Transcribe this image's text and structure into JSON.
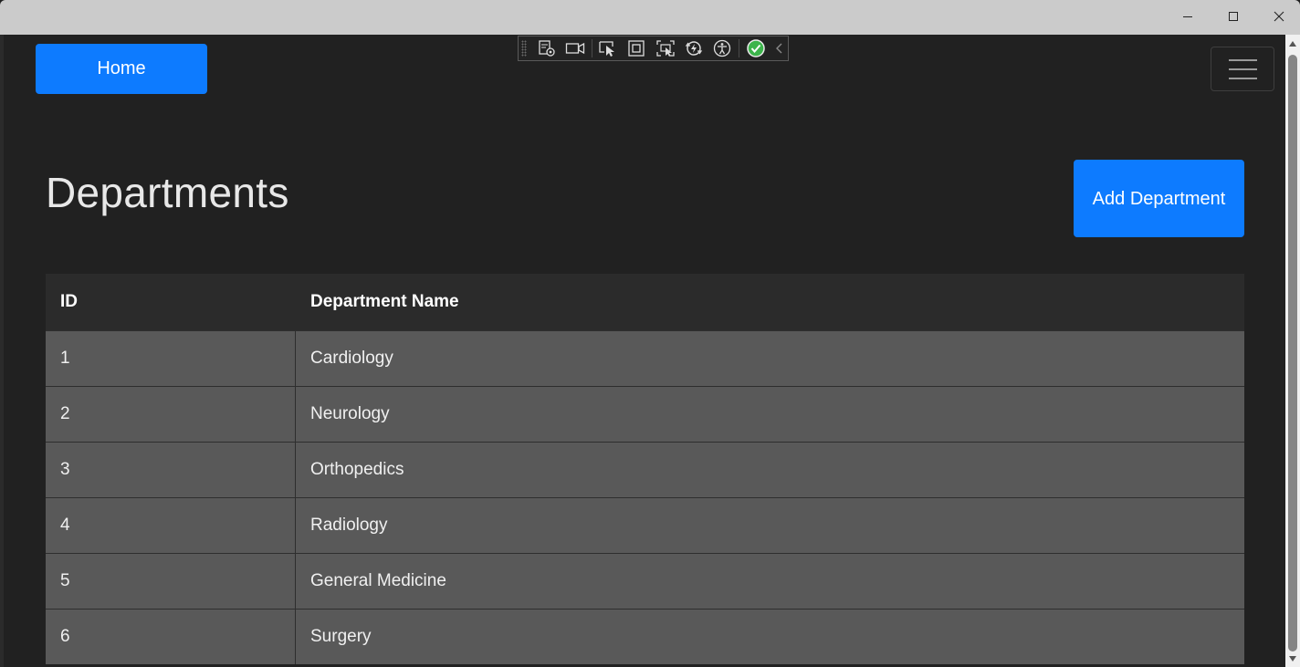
{
  "window": {
    "controls": [
      "minimize",
      "maximize",
      "close"
    ]
  },
  "nav": {
    "home_label": "Home"
  },
  "dev_toolbar": {
    "icons": [
      "select-element-icon",
      "video-record-icon",
      "pointer-select-icon",
      "frame-icon",
      "screen-select-icon",
      "hot-reload-icon",
      "accessibility-icon",
      "check-status-icon",
      "collapse-chevron-icon"
    ]
  },
  "page": {
    "title": "Departments",
    "add_button_label": "Add Department"
  },
  "table": {
    "headers": {
      "id": "ID",
      "name": "Department Name"
    },
    "rows": [
      {
        "id": "1",
        "name": "Cardiology"
      },
      {
        "id": "2",
        "name": "Neurology"
      },
      {
        "id": "3",
        "name": "Orthopedics"
      },
      {
        "id": "4",
        "name": "Radiology"
      },
      {
        "id": "5",
        "name": "General Medicine"
      },
      {
        "id": "6",
        "name": "Surgery"
      }
    ]
  },
  "colors": {
    "primary": "#0d7bff",
    "background": "#212121",
    "table_header": "#2b2b2b",
    "table_row": "#595959"
  }
}
